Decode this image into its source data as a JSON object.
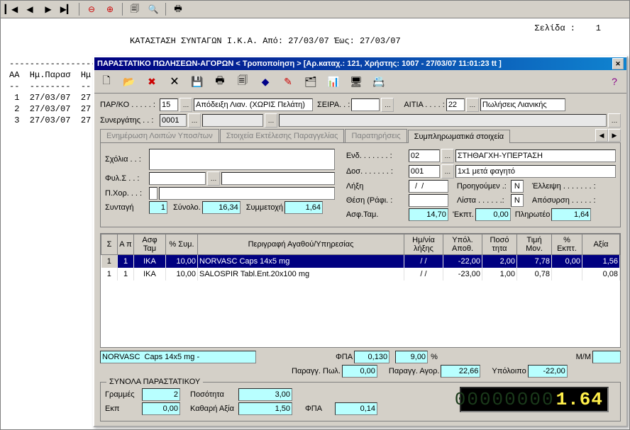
{
  "page_indicator_label": "Σελίδα :",
  "page_indicator_value": "1",
  "report_title": "ΚΑΤΑΣΤΑΣΗ ΣΥΝΤΑΓΩΝ Ι.Κ.Α. Από: 27/03/07 Έως: 27/03/07",
  "report_header": "ΑΑ  Ημ.Παρασ  Ημ",
  "report_dash_top": "-------------------",
  "report_dash": "--  --------  --",
  "report_rows": [
    " 1  27/03/07  27.",
    " 2  27/03/07  27.",
    " 3  27/03/07  27."
  ],
  "dlg_title": "ΠΑΡΑΣΤΑΤΙΚΟ ΠΩΛΗΣΕΩΝ-ΑΓΟΡΩΝ < Τροποποίηση > [Αρ.καταχ.: 121, Χρήστης: 1007 - 27/03/07 11:01:23 tt ]",
  "header": {
    "parko_lbl": "ΠΑΡ/ΚΟ . . . . . :",
    "parko_no": "15",
    "parko_desc": "Απόδειξη Λιαν. (ΧΩΡΙΣ Πελάτη)",
    "seira_lbl": "ΣΕΙΡΑ. . :",
    "seira_val": "",
    "aitia_lbl": "ΑΙΤΙΑ . . . . :",
    "aitia_no": "22",
    "aitia_desc": "Πωλήσεις Λιανικής",
    "synerg_lbl": "Συνεργάτης . . :",
    "synerg_no": "0001",
    "synerg_desc": ""
  },
  "tabs": {
    "t1": "Ενημέρωση Λοιπών Υποσ/των",
    "t2": "Στοιχεία Εκτέλεσης Παραγγελίας",
    "t3": "Παρατηρήσεις",
    "t4": "Συμπληρωματικά στοιχεία"
  },
  "suppl": {
    "sxolia_lbl": "Σχόλια . . :",
    "fyls_lbl": "Φυλ.Σ . . :",
    "pxor_lbl": "Π.Χορ. . . :",
    "syntagi_lbl": "Συνταγή",
    "syntagi_val": "1",
    "synolo_lbl": "Σύνολο.",
    "synolo_val": "16,34",
    "symm_lbl": "Συμμετοχή",
    "symm_val": "1,64",
    "end_lbl": "Ενδ. . . . . . . :",
    "end_no": "02",
    "end_desc": "ΣΤΗΘΑΓΧΗ-ΥΠΕΡΤΑΣΗ",
    "dos_lbl": "Δοσ. . . . . . . :",
    "dos_no": "001",
    "dos_desc": "1x1 μετά φαγητό",
    "lixi_lbl": "Λήξη",
    "lixi_val": "  /  /",
    "proig_lbl": "Προηγούμεν .:",
    "proig_val": "Ν",
    "elleipsi_lbl": "Έλλειψη . . . . . . . :",
    "thesi_lbl": "Θέση (Ράφι. :",
    "lista_lbl": "Λίστα . . . . . .:",
    "lista_val": "Ν",
    "aposyr_lbl": "Απόσυρση . . . . . :",
    "asftam_lbl": "Ασφ.Ταμ.",
    "asftam_val": "14,70",
    "ekpt_lbl": "'Εκπτ.",
    "ekpt_val": "0,00",
    "plir_lbl": "Πληρωτέο",
    "plir_val": "1,64"
  },
  "grid": {
    "cols": {
      "s": "Σ",
      "ap": "Α π",
      "asftam": "Ασφ Ταμ",
      "sym": "% Συμ.",
      "perigr": "Περιγραφή Αγαθού/Υπηρεσίας",
      "lixi": "Ημ/νία λήξης",
      "ypol": "Υπόλ. Αποθ.",
      "poso": "Ποσό τητα",
      "timi": "Τιμή Μον.",
      "ekpt": "% Εκπτ.",
      "axia": "Αξία"
    },
    "rows": [
      {
        "s": "1",
        "ap": "1",
        "asftam": "ΙΚΑ",
        "sym": "10,00",
        "perigr": "NORVASC  Caps 14x5 mg",
        "lixi": "  /  /",
        "ypol": "-22,00",
        "poso": "2,00",
        "timi": "7,78",
        "ekpt": "0,00",
        "axia": "1,56",
        "sel": true
      },
      {
        "s": "1",
        "ap": "1",
        "asftam": "ΙΚΑ",
        "sym": "10,00",
        "perigr": "SALOSPIR  Tabl.Ent.20x100 mg",
        "lixi": "  /  /",
        "ypol": "-23,00",
        "poso": "1,00",
        "timi": "0,78",
        "ekpt": "",
        "axia": "0,08",
        "sel": false
      }
    ]
  },
  "summary": {
    "item": "NORVASC  Caps 14x5 mg -",
    "fpa_lbl": "ΦΠΑ",
    "fpa_val": "0,130",
    "fpa_pct": "9,00",
    "pct": "%",
    "mm_lbl": "Μ/Μ",
    "parpol_lbl": "Παραγγ. Πωλ.",
    "parpol_val": "0,00",
    "paragor_lbl": "Παραγγ. Αγορ.",
    "paragor_val": "22,66",
    "ypol_lbl": "Υπόλοιπο",
    "ypol_val": "-22,00"
  },
  "totals": {
    "legend": "ΣΥΝΟΛΑ ΠΑΡΑΣΤΑΤΙΚΟΥ",
    "grammes_lbl": "Γραμμές",
    "grammes_val": "2",
    "poso_lbl": "Ποσότητα",
    "poso_val": "3,00",
    "ekp_lbl": "Εκπ",
    "ekp_val": "0,00",
    "kath_lbl": "Καθαρή Αξία",
    "kath_val": "1,50",
    "fpa_lbl": "ΦΠΑ",
    "fpa_val": "0,14",
    "lcd_ghost": "00000000",
    "lcd_live": "1.64"
  }
}
